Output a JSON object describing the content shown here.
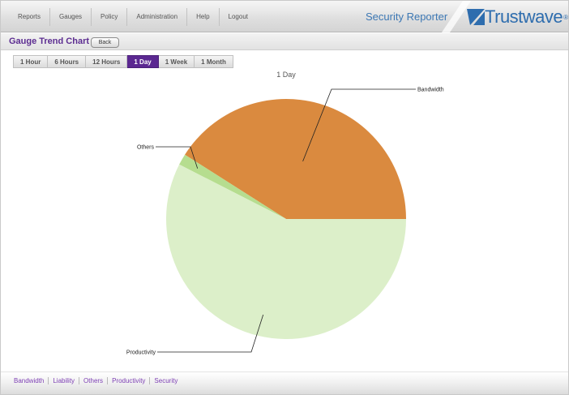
{
  "nav": {
    "items": [
      "Reports",
      "Gauges",
      "Policy",
      "Administration",
      "Help",
      "Logout"
    ]
  },
  "header": {
    "product": "Security Reporter",
    "brand": "Trustwave",
    "brand_mark": "®"
  },
  "page": {
    "title": "Gauge Trend Chart",
    "back_label": "Back"
  },
  "tabs": {
    "items": [
      "1 Hour",
      "6 Hours",
      "12 Hours",
      "1 Day",
      "1 Week",
      "1 Month"
    ],
    "active": "1 Day"
  },
  "chart_data": {
    "type": "pie",
    "title": "1 Day",
    "slices": [
      {
        "label": "Bandwidth",
        "value": 41,
        "color": "#da8a3f"
      },
      {
        "label": "Others",
        "value": 1.5,
        "color": "#b6dd8f"
      },
      {
        "label": "Productivity",
        "value": 57.5,
        "color": "#dcefc9"
      }
    ]
  },
  "legend": {
    "items": [
      "Bandwidth",
      "Liability",
      "Others",
      "Productivity",
      "Security"
    ]
  },
  "colors": {
    "accent": "#5b2891",
    "brand": "#2e6dae",
    "legend_link": "#7d3fb4"
  }
}
